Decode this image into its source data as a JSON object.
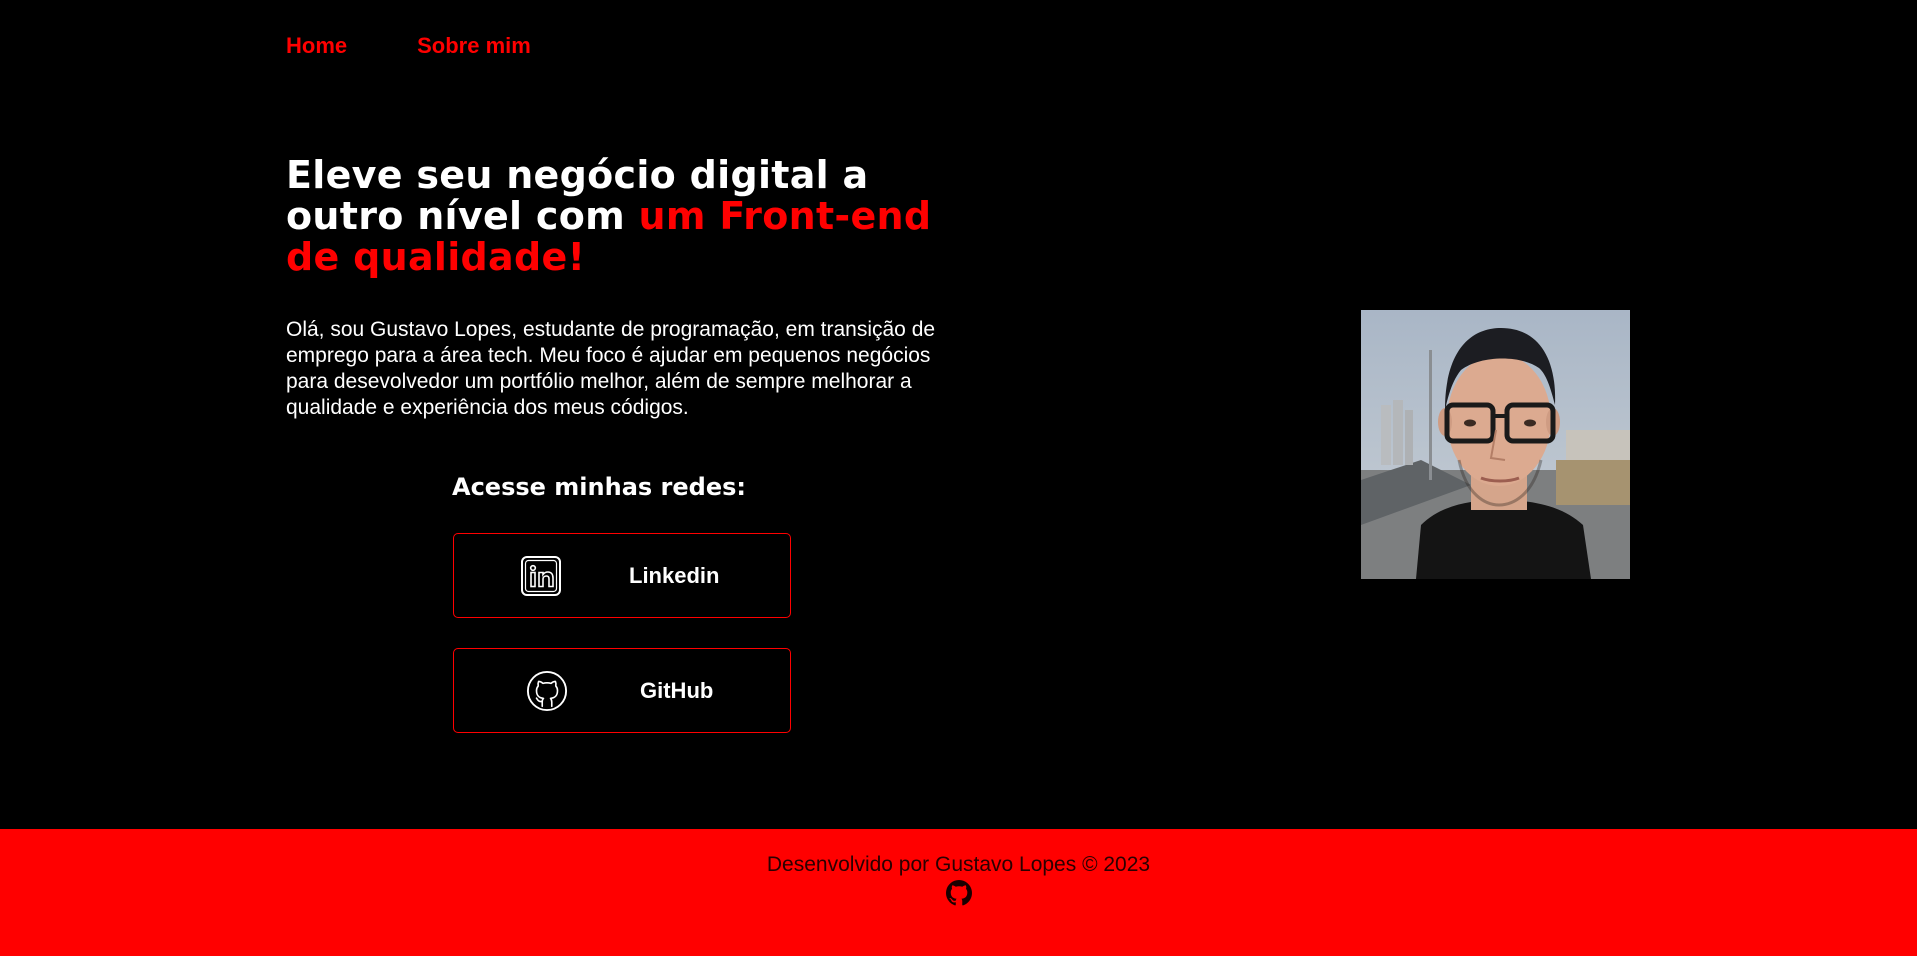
{
  "nav": {
    "home": "Home",
    "about": "Sobre mim"
  },
  "hero": {
    "headline_part1": "Eleve seu negócio digital a outro nível com ",
    "headline_accent": "um Front-end de qualidade!",
    "bio": "Olá, sou Gustavo Lopes, estudante de programação, em transição de emprego para a área tech. Meu foco é ajudar em pequenos negócios para desevolvedor um portfólio melhor, além de sempre melhorar a qualidade e experiência dos meus códigos."
  },
  "socials": {
    "title": "Acesse minhas redes:",
    "linkedin": {
      "label": "Linkedin",
      "icon": "linkedin-icon"
    },
    "github": {
      "label": "GitHub",
      "icon": "github-icon"
    }
  },
  "photo": {
    "icon": "profile-photo"
  },
  "footer": {
    "credit": "Desenvolvido por Gustavo Lopes © 2023",
    "icon": "github-icon"
  },
  "colors": {
    "background": "#000000",
    "accent": "#ff0000",
    "text": "#ffffff"
  }
}
